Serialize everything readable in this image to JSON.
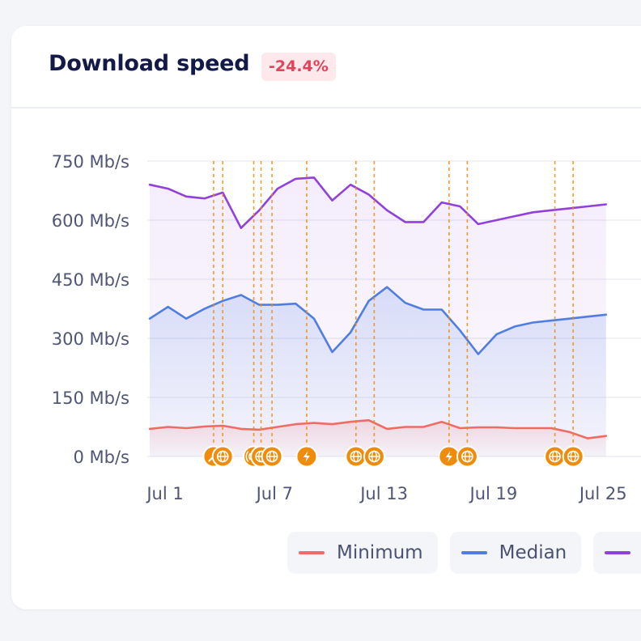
{
  "card": {
    "title": "Download speed",
    "delta": "-24.4%"
  },
  "colors": {
    "minimum": "#ee6c63",
    "median": "#4f7ee0",
    "maximum": "#9140dc",
    "event": "#f08c0c",
    "delta_text": "#e0445a"
  },
  "chart_data": {
    "type": "area",
    "xlabel": "",
    "ylabel": "",
    "x": [
      "Jul 1",
      "Jul 2",
      "Jul 3",
      "Jul 4",
      "Jul 5",
      "Jul 6",
      "Jul 7",
      "Jul 8",
      "Jul 9",
      "Jul 10",
      "Jul 11",
      "Jul 12",
      "Jul 13",
      "Jul 14",
      "Jul 15",
      "Jul 16",
      "Jul 17",
      "Jul 18",
      "Jul 19",
      "Jul 20",
      "Jul 21",
      "Jul 22",
      "Jul 23",
      "Jul 24",
      "Jul 25",
      "Jul 26"
    ],
    "x_ticks": [
      "Jul 1",
      "Jul 7",
      "Jul 13",
      "Jul 19",
      "Jul 25"
    ],
    "y_ticks": [
      "0 Mb/s",
      "150 Mb/s",
      "300 Mb/s",
      "450 Mb/s",
      "600 Mb/s",
      "750 Mb/s"
    ],
    "ylim": [
      0,
      750
    ],
    "grid": true,
    "series": [
      {
        "name": "Minimum",
        "values": [
          70,
          75,
          72,
          76,
          78,
          70,
          68,
          75,
          82,
          85,
          82,
          88,
          92,
          70,
          75,
          75,
          88,
          72,
          74,
          74,
          72,
          72,
          72,
          62,
          46,
          52
        ]
      },
      {
        "name": "Median",
        "values": [
          350,
          380,
          350,
          375,
          395,
          410,
          385,
          385,
          388,
          350,
          265,
          315,
          395,
          430,
          390,
          373,
          373,
          320,
          260,
          310,
          330,
          340,
          345,
          350,
          355,
          360
        ]
      },
      {
        "name": "",
        "values": [
          690,
          680,
          660,
          655,
          670,
          580,
          625,
          680,
          705,
          708,
          650,
          690,
          665,
          625,
          595,
          595,
          645,
          635,
          590,
          600,
          610,
          620,
          625,
          630,
          635,
          640
        ]
      }
    ],
    "events": [
      {
        "day": 4.5,
        "icon": "wrench-icon"
      },
      {
        "day": 5.0,
        "icon": "globe-icon"
      },
      {
        "day": 6.7,
        "icon": "broadcast-icon"
      },
      {
        "day": 7.1,
        "icon": "globe-icon"
      },
      {
        "day": 7.7,
        "icon": "globe-icon"
      },
      {
        "day": 9.6,
        "icon": "bolt-icon"
      },
      {
        "day": 12.3,
        "icon": "globe-icon"
      },
      {
        "day": 13.3,
        "icon": "globe-icon"
      },
      {
        "day": 17.4,
        "icon": "bolt-icon"
      },
      {
        "day": 18.4,
        "icon": "globe-icon"
      },
      {
        "day": 23.2,
        "icon": "globe-icon"
      },
      {
        "day": 24.2,
        "icon": "globe-icon"
      }
    ]
  },
  "legend": [
    {
      "label": "Minimum",
      "color": "#ee6c63"
    },
    {
      "label": "Median",
      "color": "#4f7ee0"
    },
    {
      "label": "",
      "color": "#9140dc"
    }
  ]
}
